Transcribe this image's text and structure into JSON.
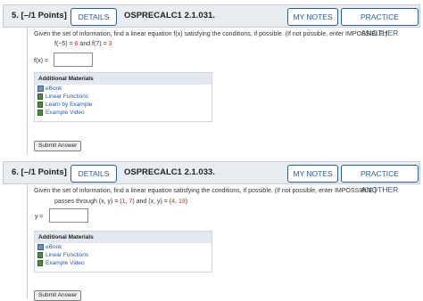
{
  "q5": {
    "number": "5.  [–/1 Points]",
    "details": "DETAILS",
    "code": "OSPRECALC1 2.1.031.",
    "my_notes": "MY NOTES",
    "practice": "PRACTICE ANOTHER",
    "prompt": "Given the set of information, find a linear equation  f(x)  satisfying the conditions, if possible. (If not possible, enter IMPOSSIBLE.)",
    "cond_pre1": "f(−5) = ",
    "cond_v1": "6",
    "cond_mid": " and f(7) = ",
    "cond_v2": "3",
    "answer_label": "f(x) =",
    "answer_value": "",
    "materials_title": "Additional Materials",
    "materials": [
      "eBook",
      "Linear Functions",
      "Learn by Example",
      "Example Video"
    ],
    "submit": "Submit Answer"
  },
  "q6": {
    "number": "6.  [–/1 Points]",
    "details": "DETAILS",
    "code": "OSPRECALC1 2.1.033.",
    "my_notes": "MY NOTES",
    "practice": "PRACTICE ANOTHER",
    "prompt": "Given the set of information, find a linear equation satisfying the conditions, if possible. (If not possible, enter IMPOSSIBLE.)",
    "cond_pre": "passes through (x, y) = (",
    "cond_a": "1",
    "cond_sep1": ", ",
    "cond_b": "7",
    "cond_mid": ") and (x, y) = (",
    "cond_c": "4",
    "cond_sep2": ", ",
    "cond_d": "19",
    "cond_end": ")",
    "answer_label": "y =",
    "answer_value": "",
    "materials_title": "Additional Materials",
    "materials": [
      "eBook",
      "Linear Functions",
      "Example Video"
    ],
    "submit": "Submit Answer"
  }
}
